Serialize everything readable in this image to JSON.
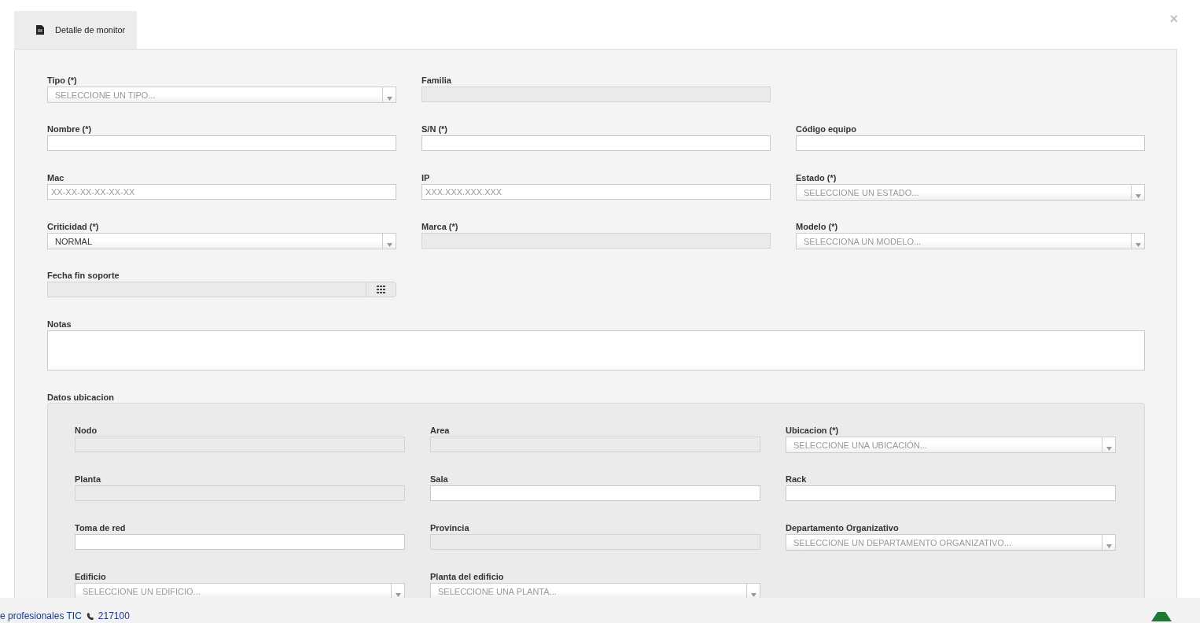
{
  "tab": {
    "label": "Detalle de monitor",
    "selected": true
  },
  "close": "×",
  "rows": [
    [
      {
        "label": "Tipo (*)",
        "kind": "select",
        "placeholder": "SELECCIONE UN TIPO..."
      },
      {
        "label": "Familia",
        "kind": "disabled"
      }
    ],
    [
      {
        "label": "Nombre (*)",
        "kind": "text"
      },
      {
        "label": "S/N (*)",
        "kind": "text"
      },
      {
        "label": "Código equipo",
        "kind": "text"
      }
    ],
    [
      {
        "label": "Mac",
        "kind": "text",
        "placeholder": "XX-XX-XX-XX-XX-XX"
      },
      {
        "label": "IP",
        "kind": "text",
        "placeholder": "XXX.XXX.XXX.XXX"
      },
      {
        "label": "Estado (*)",
        "kind": "select",
        "placeholder": "SELECCIONE UN ESTADO..."
      }
    ],
    [
      {
        "label": "Criticidad (*)",
        "kind": "select",
        "value": "NORMAL"
      },
      {
        "label": "Marca (*)",
        "kind": "disabled"
      },
      {
        "label": "Modelo (*)",
        "kind": "select",
        "placeholder": "SELECCIONA UN MODELO..."
      }
    ],
    [
      {
        "label": "Fecha fin soporte",
        "kind": "date"
      }
    ],
    [
      {
        "label": "Notas",
        "kind": "textarea"
      }
    ]
  ],
  "location": {
    "title": "Datos ubicacion",
    "rows": [
      [
        {
          "label": "Nodo",
          "kind": "disabled"
        },
        {
          "label": "Area",
          "kind": "disabled"
        },
        {
          "label": "Ubicacion (*)",
          "kind": "select",
          "placeholder": "SELECCIONE UNA UBICACIÓN..."
        }
      ],
      [
        {
          "label": "Planta",
          "kind": "disabled"
        },
        {
          "label": "Sala",
          "kind": "text"
        },
        {
          "label": "Rack",
          "kind": "text"
        }
      ],
      [
        {
          "label": "Toma de red",
          "kind": "text"
        },
        {
          "label": "Provincia",
          "kind": "disabled"
        },
        {
          "label": "Departamento Organizativo",
          "kind": "select",
          "placeholder": "SELECCIONE UN DEPARTAMENTO ORGANIZATIVO..."
        }
      ],
      [
        {
          "label": "Edificio",
          "kind": "select",
          "placeholder": "SELECCIONE UN EDIFICIO..."
        },
        {
          "label": "Planta del edificio",
          "kind": "select",
          "placeholder": "SELECCIONE UNA PLANTA..."
        }
      ]
    ]
  },
  "footer": {
    "text": "e profesionales TIC",
    "phone": "217100"
  }
}
